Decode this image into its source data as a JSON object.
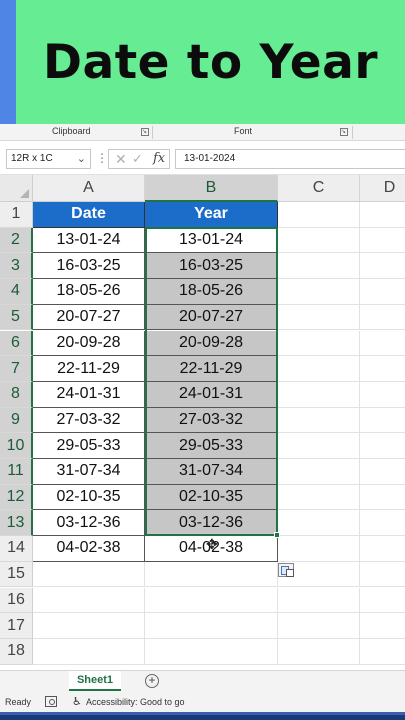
{
  "banner": {
    "title": "Date to Year"
  },
  "ribbon": {
    "groups": [
      {
        "label": "Clipboard"
      },
      {
        "label": "Font"
      }
    ]
  },
  "formula_bar": {
    "name_box": "12R x 1C",
    "formula": "13-01-2024",
    "fx_label": "fx"
  },
  "grid": {
    "columns": [
      "A",
      "B",
      "C",
      "D"
    ],
    "rows": [
      "1",
      "2",
      "3",
      "4",
      "5",
      "6",
      "7",
      "8",
      "9",
      "10",
      "11",
      "12",
      "13",
      "14",
      "15",
      "16",
      "17",
      "18"
    ],
    "headers": {
      "A": "Date",
      "B": "Year"
    },
    "data": [
      {
        "date": "13-01-24",
        "year": "13-01-24"
      },
      {
        "date": "16-03-25",
        "year": "16-03-25"
      },
      {
        "date": "18-05-26",
        "year": "18-05-26"
      },
      {
        "date": "20-07-27",
        "year": "20-07-27"
      },
      {
        "date": "20-09-28",
        "year": "20-09-28"
      },
      {
        "date": "22-11-29",
        "year": "22-11-29"
      },
      {
        "date": "24-01-31",
        "year": "24-01-31"
      },
      {
        "date": "27-03-32",
        "year": "27-03-32"
      },
      {
        "date": "29-05-33",
        "year": "29-05-33"
      },
      {
        "date": "31-07-34",
        "year": "31-07-34"
      },
      {
        "date": "02-10-35",
        "year": "02-10-35"
      },
      {
        "date": "03-12-36",
        "year": "03-12-36"
      },
      {
        "date": "04-02-38",
        "year": "04-02-38"
      }
    ]
  },
  "sheet_tabs": {
    "active": "Sheet1",
    "add_label": "+"
  },
  "status_bar": {
    "ready": "Ready",
    "accessibility": "Accessibility: Good to go"
  },
  "colors": {
    "accent": "#217346",
    "header_fill": "#1b6dc9",
    "banner": "#66ec93",
    "selection_fill": "#c6c6c6"
  }
}
